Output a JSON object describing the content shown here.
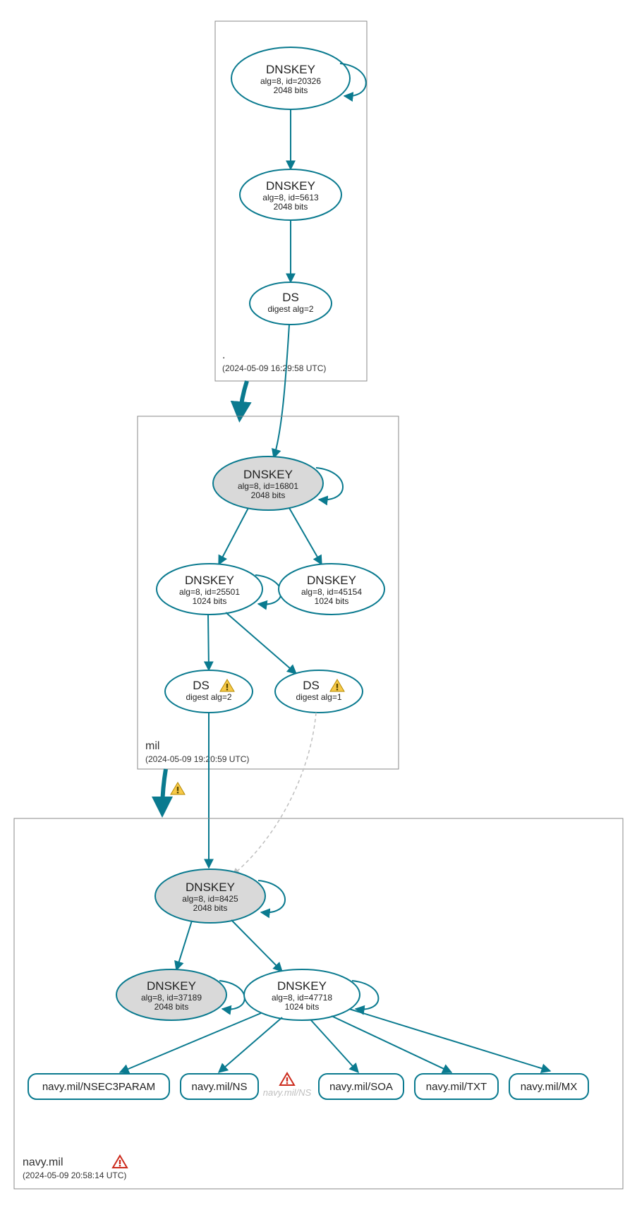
{
  "chart_data": {
    "type": "diagram",
    "title": "DNSSEC authentication graph",
    "zones": [
      {
        "name": ".",
        "timestamp": "(2024-05-09 16:29:58 UTC)",
        "nodes": [
          {
            "id": "root-ksk",
            "type": "DNSKEY",
            "lines": [
              "DNSKEY",
              "alg=8, id=20326",
              "2048 bits"
            ],
            "double_border": true,
            "grey": true,
            "self_loop": true
          },
          {
            "id": "root-zsk",
            "type": "DNSKEY",
            "lines": [
              "DNSKEY",
              "alg=8, id=5613",
              "2048 bits"
            ]
          },
          {
            "id": "root-ds",
            "type": "DS",
            "lines": [
              "DS",
              "digest alg=2"
            ]
          }
        ],
        "edges": [
          {
            "from": "root-ksk",
            "to": "root-zsk"
          },
          {
            "from": "root-zsk",
            "to": "root-ds"
          }
        ]
      },
      {
        "name": "mil",
        "timestamp": "(2024-05-09 19:20:59 UTC)",
        "nodes": [
          {
            "id": "mil-ksk",
            "type": "DNSKEY",
            "lines": [
              "DNSKEY",
              "alg=8, id=16801",
              "2048 bits"
            ],
            "grey": true,
            "self_loop": true
          },
          {
            "id": "mil-zsk1",
            "type": "DNSKEY",
            "lines": [
              "DNSKEY",
              "alg=8, id=25501",
              "1024 bits"
            ],
            "self_loop": true
          },
          {
            "id": "mil-zsk2",
            "type": "DNSKEY",
            "lines": [
              "DNSKEY",
              "alg=8, id=45154",
              "1024 bits"
            ]
          },
          {
            "id": "mil-ds2",
            "type": "DS",
            "lines": [
              "DS",
              "digest alg=2"
            ],
            "warning": true
          },
          {
            "id": "mil-ds1",
            "type": "DS",
            "lines": [
              "DS",
              "digest alg=1"
            ],
            "warning": true
          }
        ],
        "edges": [
          {
            "from": "mil-ksk",
            "to": "mil-zsk1"
          },
          {
            "from": "mil-ksk",
            "to": "mil-zsk2"
          },
          {
            "from": "mil-zsk1",
            "to": "mil-ds2"
          },
          {
            "from": "mil-zsk1",
            "to": "mil-ds1"
          }
        ]
      },
      {
        "name": "navy.mil",
        "timestamp": "(2024-05-09 20:58:14 UTC)",
        "error": true,
        "nodes": [
          {
            "id": "navy-ksk",
            "type": "DNSKEY",
            "lines": [
              "DNSKEY",
              "alg=8, id=8425",
              "2048 bits"
            ],
            "grey": true,
            "self_loop": true
          },
          {
            "id": "navy-zsk2",
            "type": "DNSKEY",
            "lines": [
              "DNSKEY",
              "alg=8, id=37189",
              "2048 bits"
            ],
            "grey": true,
            "self_loop": true
          },
          {
            "id": "navy-zsk1",
            "type": "DNSKEY",
            "lines": [
              "DNSKEY",
              "alg=8, id=47718",
              "1024 bits"
            ],
            "self_loop": true
          }
        ],
        "rrsets": [
          "navy.mil/NSEC3PARAM",
          "navy.mil/NS",
          "navy.mil/SOA",
          "navy.mil/TXT",
          "navy.mil/MX"
        ],
        "ghost_rrset": "navy.mil/NS",
        "edges": [
          {
            "from": "navy-ksk",
            "to": "navy-zsk2"
          },
          {
            "from": "navy-ksk",
            "to": "navy-zsk1"
          },
          {
            "from": "navy-zsk1",
            "to": "rr-0"
          },
          {
            "from": "navy-zsk1",
            "to": "rr-1"
          },
          {
            "from": "navy-zsk1",
            "to": "rr-2"
          },
          {
            "from": "navy-zsk1",
            "to": "rr-3"
          },
          {
            "from": "navy-zsk1",
            "to": "rr-4"
          }
        ]
      }
    ],
    "interzone_edges": [
      {
        "from_zone": ".",
        "to_zone": "mil",
        "style": "thick"
      },
      {
        "from_zone": ".",
        "from_node": "root-ds",
        "to_zone": "mil",
        "to_node": "mil-ksk",
        "style": "normal"
      },
      {
        "from_zone": "mil",
        "to_zone": "navy.mil",
        "style": "thick",
        "warning": true
      },
      {
        "from_zone": "mil",
        "from_node": "mil-ds2",
        "to_zone": "navy.mil",
        "to_node": "navy-ksk",
        "style": "normal"
      },
      {
        "from_zone": "mil",
        "from_node": "mil-ds1",
        "to_zone": "navy.mil",
        "to_node": "navy-ksk",
        "style": "dashed"
      }
    ]
  },
  "icons": {
    "warning_yellow": "warning-icon",
    "warning_red": "error-icon"
  }
}
